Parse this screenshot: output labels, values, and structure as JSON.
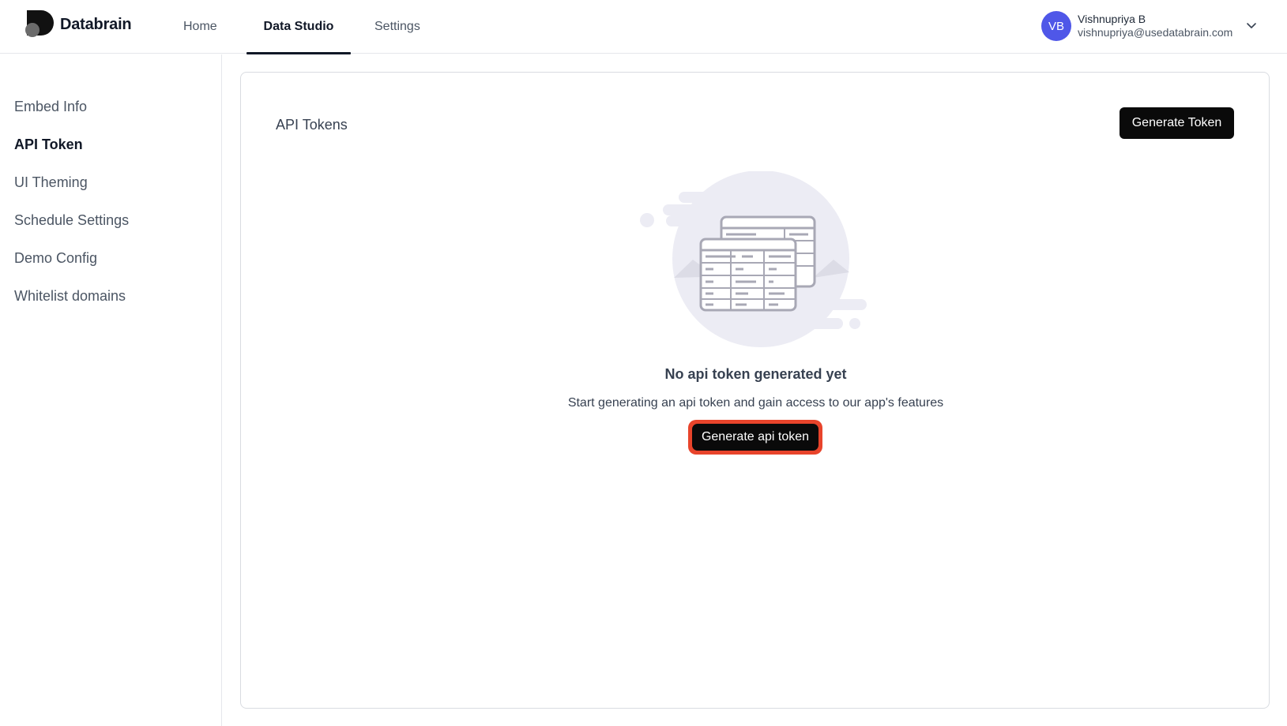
{
  "app": {
    "brand": "Databrain"
  },
  "nav": {
    "tabs": [
      {
        "label": "Home"
      },
      {
        "label": "Data Studio"
      },
      {
        "label": "Settings"
      }
    ],
    "active_tab": "Data Studio"
  },
  "user": {
    "initials": "VB",
    "name": "Vishnupriya B",
    "email": "vishnupriya@usedatabrain.com",
    "avatar_color": "#4f57e8"
  },
  "sidebar": {
    "items": [
      {
        "label": "Embed Info"
      },
      {
        "label": "API Token"
      },
      {
        "label": "UI Theming"
      },
      {
        "label": "Schedule Settings"
      },
      {
        "label": "Demo Config"
      },
      {
        "label": "Whitelist domains"
      }
    ],
    "active_item": "API Token"
  },
  "main": {
    "title": "API Tokens",
    "generate_token_label": "Generate Token",
    "empty_state": {
      "icon": "table-empty-illustration",
      "title": "No api token generated yet",
      "subtitle": "Start generating an api token and gain access to our app's features",
      "button_label": "Generate api token",
      "highlight_color": "#e8442b"
    }
  },
  "icons": {
    "logo": "databrain-logo-icon",
    "dropdown": "chevron-down-icon"
  }
}
